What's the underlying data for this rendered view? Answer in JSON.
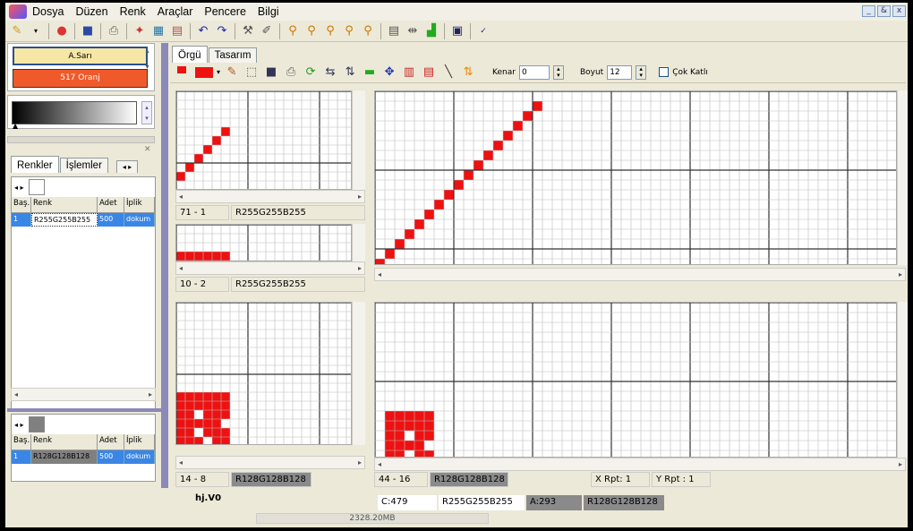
{
  "menu": [
    "Dosya",
    "Düzen",
    "Renk",
    "Araçlar",
    "Pencere",
    "Bilgi"
  ],
  "window_controls": [
    "_",
    "&",
    "x"
  ],
  "toolbar_icons": [
    "new-icon",
    "open-icon",
    "save-icon",
    "print-icon",
    "undo-icon",
    "redo-icon",
    "zoom-icon",
    "spellcheck-icon"
  ],
  "palette": {
    "color1": {
      "label": "A.Sarı",
      "hex": "#f6e7a5"
    },
    "color2": {
      "label": "517 Oranj",
      "hex": "#f05a2a"
    }
  },
  "left_tabs": [
    "Renkler",
    "İşlemler"
  ],
  "table_headers": [
    "Baş.",
    "Renk",
    "Adet",
    "İplik"
  ],
  "table1_row": [
    "1",
    "R255G255B255",
    "500",
    "dokum"
  ],
  "table2_row": [
    "1",
    "R128G128B128",
    "500",
    "dokum"
  ],
  "main_tabs": [
    "Örgü",
    "Tasarım"
  ],
  "draw_toolbar": {
    "kenar_label": "Kenar",
    "kenar_value": "0",
    "boyut_label": "Boyut",
    "boyut_value": "12",
    "cok_katli_label": "Çok Katlı"
  },
  "panels": {
    "p1": {
      "coord": "71 - 1",
      "color": "R255G255B255"
    },
    "p2": {
      "coord": "10 - 2",
      "color": "R255G255B255"
    },
    "p3": {
      "coord": "14 - 8",
      "color": "R128G128B128"
    },
    "p4": {
      "coord": "44 - 16",
      "color": "R128G128B128",
      "x_rpt": "X Rpt: 1",
      "y_rpt": "Y Rpt : 1"
    }
  },
  "status": {
    "file": "hj.V0",
    "c": "C:479",
    "color1": "R255G255B255",
    "a": "A:293",
    "color2": "R128G128B128",
    "memory": "2328.20MB"
  },
  "accent_red": "#ee1111"
}
